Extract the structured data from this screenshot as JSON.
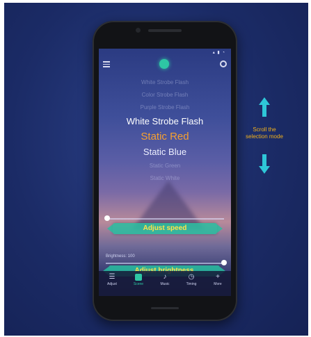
{
  "mode_list": {
    "items": [
      {
        "label": "White Strobe Flash",
        "state": "faint"
      },
      {
        "label": "Color Strobe Flash",
        "state": "faint"
      },
      {
        "label": "Purple Strobe Flash",
        "state": "faint"
      },
      {
        "label": "White Strobe Flash",
        "state": "near"
      },
      {
        "label": "Static Red",
        "state": "selected"
      },
      {
        "label": "Static Blue",
        "state": "near"
      },
      {
        "label": "Static Green",
        "state": "faint"
      },
      {
        "label": "Static White",
        "state": "faint"
      }
    ]
  },
  "controls": {
    "speed_banner": "Adjust speed",
    "brightness_label": "Brightness: 100",
    "brightness_banner": "Adjust brightness"
  },
  "tabs": [
    {
      "label": "Adjust",
      "icon": "sliders-icon",
      "glyph": "☰"
    },
    {
      "label": "Scene",
      "icon": "scene-icon",
      "glyph": "■",
      "active": true
    },
    {
      "label": "Music",
      "icon": "music-icon",
      "glyph": "♪"
    },
    {
      "label": "Timing",
      "icon": "clock-icon",
      "glyph": "◷"
    },
    {
      "label": "More",
      "icon": "plus-icon",
      "glyph": "+"
    }
  ],
  "annotation": {
    "scroll_text_line1": "Scroll the",
    "scroll_text_line2": "selection mode"
  },
  "colors": {
    "accent": "#2ec7a4",
    "selected_mode": "#f6a030",
    "annotation_text": "#f2b21c",
    "arrow": "#2ec7d8",
    "background": "#1b2b66"
  }
}
